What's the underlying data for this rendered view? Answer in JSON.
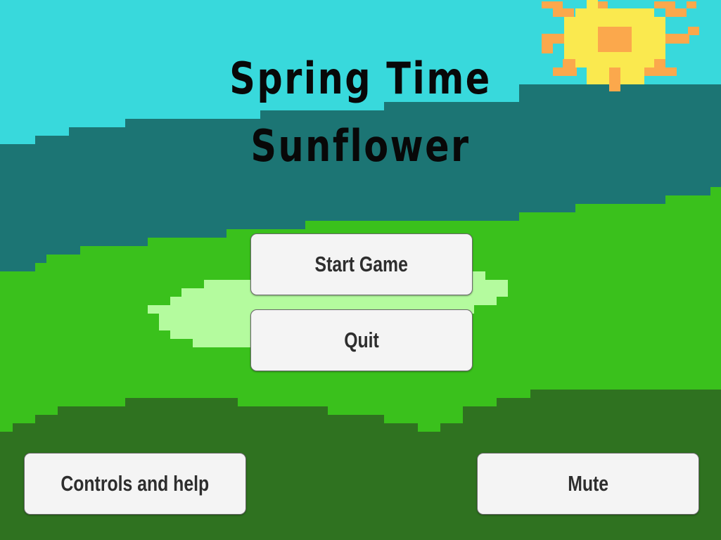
{
  "title": {
    "line1": "Spring Time",
    "line2": "Sunflower"
  },
  "menu": {
    "start_label": "Start Game",
    "quit_label": "Quit",
    "help_label": "Controls and help",
    "mute_label": "Mute"
  },
  "colors": {
    "sky": "#38d9dc",
    "far_hill": "#1c7574",
    "meadow": "#3ac11c",
    "pond": "#b4fb9e",
    "foreground_grass": "#2f7220",
    "sun_core": "#fae94f",
    "sun_rays": "#fba84c",
    "button_face": "#f4f4f4",
    "button_text": "#2e2e2e",
    "title_text": "#080808"
  },
  "scene": {
    "icons": [
      "sun-icon",
      "pond"
    ]
  }
}
